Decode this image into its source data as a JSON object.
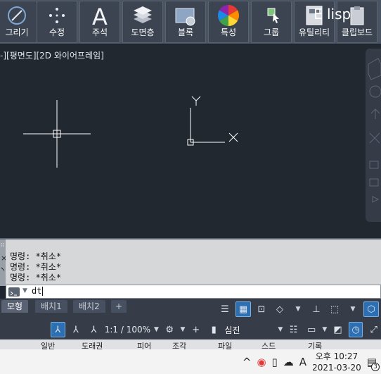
{
  "ribbon": {
    "buttons": [
      {
        "label": "그리기",
        "icon": "draw-icon"
      },
      {
        "label": "수정",
        "icon": "modify-icon"
      },
      {
        "label": "주석",
        "icon": "annotation-icon"
      },
      {
        "label": "도면층",
        "icon": "layers-icon"
      },
      {
        "label": "블록",
        "icon": "block-icon"
      },
      {
        "label": "특성",
        "icon": "properties-icon"
      },
      {
        "label": "그룹",
        "icon": "group-icon"
      },
      {
        "label": "유틸리티",
        "icon": "utilities-icon"
      },
      {
        "label": "클립보드",
        "icon": "clipboard-icon"
      }
    ],
    "overlay_text": "E lisp"
  },
  "viewport": {
    "label": "-][평면도][2D 와이어프레임]",
    "ucs_y": "Y",
    "ucs_x": "X"
  },
  "command": {
    "history": [
      "명령: *취소*",
      "명령: *취소*",
      "명령: *취소*"
    ],
    "input_value": "dt"
  },
  "tabs": {
    "items": [
      "모형",
      "배치1",
      "배치2",
      "+"
    ],
    "active": "모형"
  },
  "status": {
    "scale": "1:1 / 100%",
    "workspace": "심진"
  },
  "taskbar_strip": {
    "items": [
      "일반",
      "도래권",
      "피어",
      "조각",
      "파일",
      "스드",
      "기록"
    ]
  },
  "system_tray": {
    "time": "오후 10:27",
    "date": "2021-03-20",
    "ime": "A",
    "notification_count": "3"
  },
  "colors": {
    "accent": "#2c6fb3",
    "ribbon_bg": "#4a5463",
    "canvas_bg": "#212830"
  }
}
